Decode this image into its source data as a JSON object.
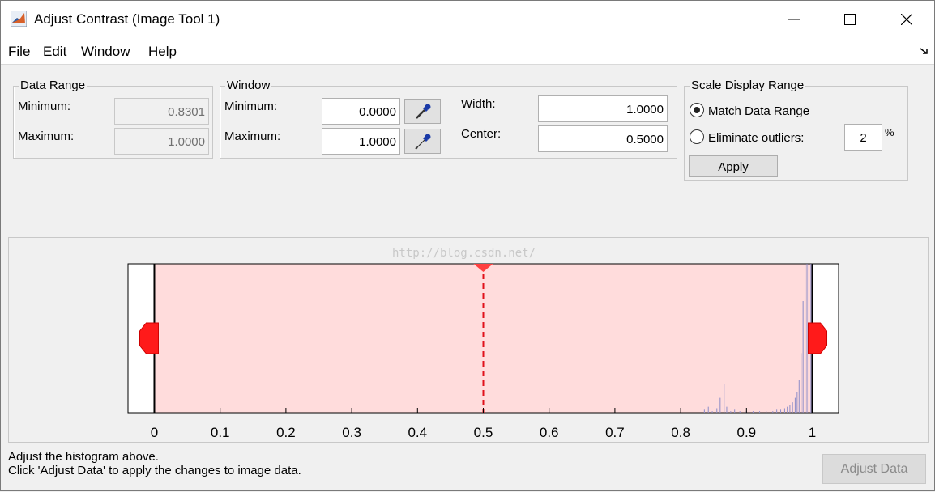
{
  "window": {
    "title": "Adjust Contrast (Image Tool 1)"
  },
  "menu": [
    {
      "label": "File",
      "mnemonic": "F",
      "rest": "ile"
    },
    {
      "label": "Edit",
      "mnemonic": "E",
      "rest": "dit"
    },
    {
      "label": "Window",
      "mnemonic": "W",
      "rest": "indow"
    },
    {
      "label": "Help",
      "mnemonic": "H",
      "rest": "elp"
    }
  ],
  "data_range": {
    "title": "Data Range",
    "min_label": "Minimum:",
    "min_value": "0.8301",
    "max_label": "Maximum:",
    "max_value": "1.0000"
  },
  "window_panel": {
    "title": "Window",
    "min_label": "Minimum:",
    "min_value": "0.0000",
    "max_label": "Maximum:",
    "max_value": "1.0000",
    "width_label": "Width:",
    "width_value": "1.0000",
    "center_label": "Center:",
    "center_value": "0.5000"
  },
  "scale": {
    "title": "Scale Display Range",
    "match_label": "Match Data Range",
    "match_selected": true,
    "eliminate_label": "Eliminate outliers:",
    "outlier_value": "2",
    "percent": "%",
    "apply_label": "Apply"
  },
  "histogram": {
    "xlim": [
      -0.04,
      1.04
    ],
    "window_min": 0.0,
    "window_max": 1.0,
    "center": 0.5,
    "ticks": [
      "0",
      "0.1",
      "0.2",
      "0.3",
      "0.4",
      "0.5",
      "0.6",
      "0.7",
      "0.8",
      "0.9",
      "1"
    ],
    "tick_values": [
      0,
      0.1,
      0.2,
      0.3,
      0.4,
      0.5,
      0.6,
      0.7,
      0.8,
      0.9,
      1.0
    ],
    "bins": [
      {
        "x": 0.836,
        "h": 0.02
      },
      {
        "x": 0.842,
        "h": 0.04
      },
      {
        "x": 0.848,
        "h": 0.01
      },
      {
        "x": 0.855,
        "h": 0.03
      },
      {
        "x": 0.86,
        "h": 0.1
      },
      {
        "x": 0.866,
        "h": 0.19
      },
      {
        "x": 0.87,
        "h": 0.04
      },
      {
        "x": 0.876,
        "h": 0.01
      },
      {
        "x": 0.882,
        "h": 0.02
      },
      {
        "x": 0.89,
        "h": 0.01
      },
      {
        "x": 0.9,
        "h": 0.01
      },
      {
        "x": 0.91,
        "h": 0.01
      },
      {
        "x": 0.92,
        "h": 0.01
      },
      {
        "x": 0.93,
        "h": 0.01
      },
      {
        "x": 0.94,
        "h": 0.01
      },
      {
        "x": 0.946,
        "h": 0.02
      },
      {
        "x": 0.952,
        "h": 0.02
      },
      {
        "x": 0.958,
        "h": 0.03
      },
      {
        "x": 0.962,
        "h": 0.04
      },
      {
        "x": 0.966,
        "h": 0.05
      },
      {
        "x": 0.97,
        "h": 0.07
      },
      {
        "x": 0.974,
        "h": 0.1
      },
      {
        "x": 0.977,
        "h": 0.14
      },
      {
        "x": 0.98,
        "h": 0.22
      },
      {
        "x": 0.983,
        "h": 0.4
      },
      {
        "x": 0.986,
        "h": 0.75
      },
      {
        "x": 0.989,
        "h": 1.0
      },
      {
        "x": 0.992,
        "h": 1.0
      },
      {
        "x": 0.995,
        "h": 1.0
      },
      {
        "x": 0.998,
        "h": 1.0
      }
    ]
  },
  "watermark": "http://blog.csdn.net/",
  "help": {
    "line1": "Adjust the histogram above.",
    "line2": "Click 'Adjust Data' to apply the changes to image data."
  },
  "adjust_data_label": "Adjust Data",
  "colors": {
    "window_fill": "#ffdcdc",
    "handle": "#ff1a1a",
    "bar": "#8c8cc8"
  }
}
